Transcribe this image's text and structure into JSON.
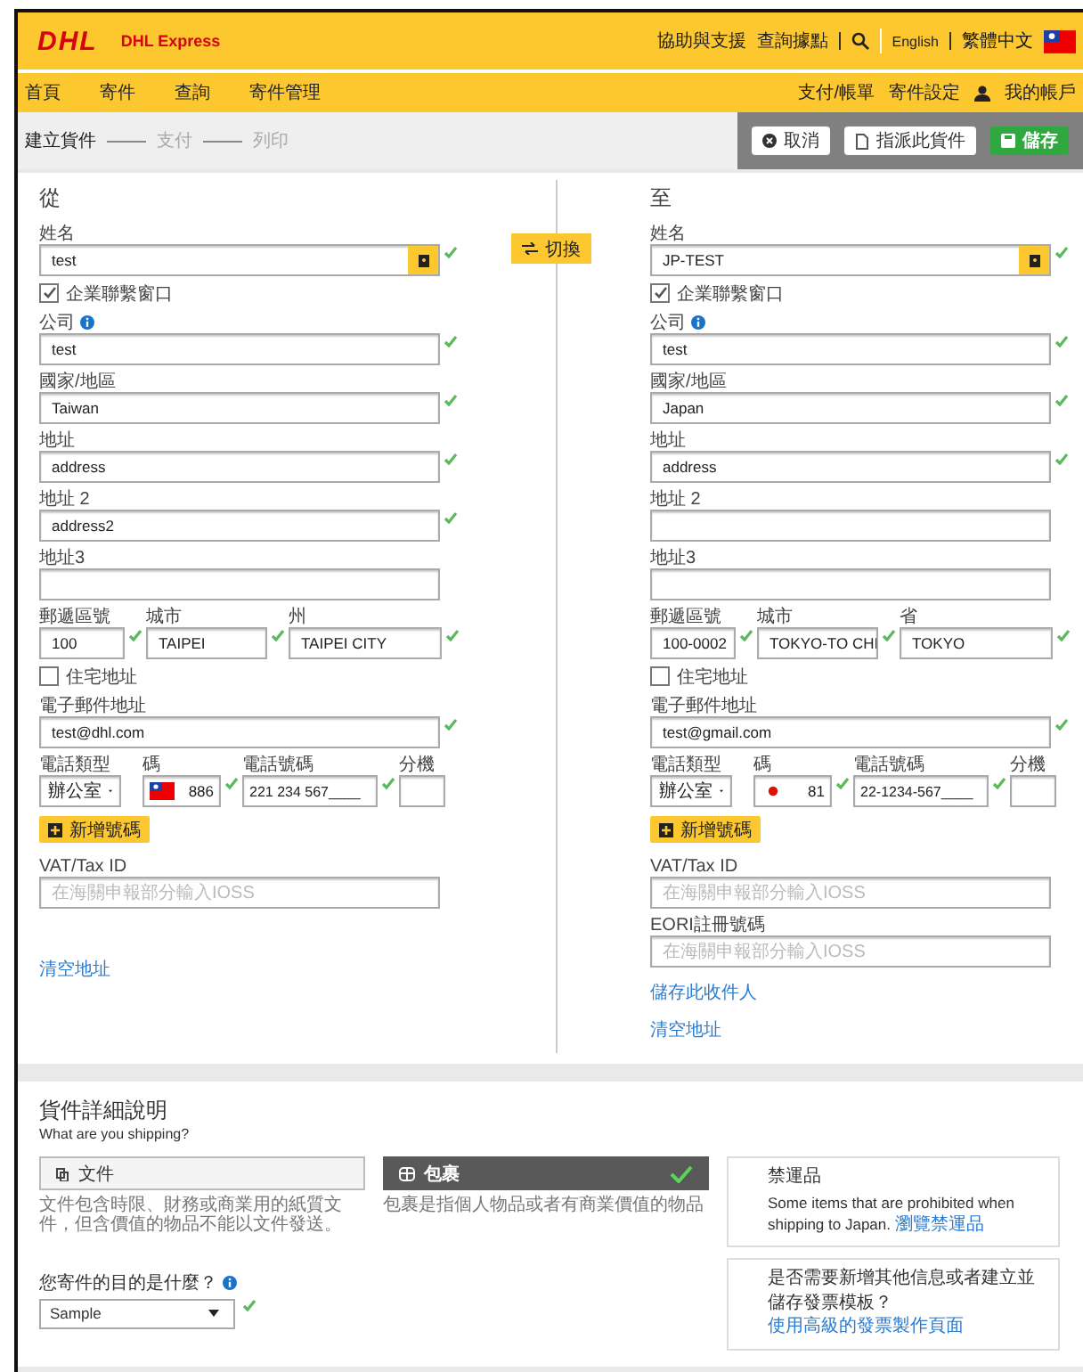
{
  "header": {
    "logo": "DHL",
    "brand": "DHL Express",
    "links": [
      "協助與支援",
      "查詢據點"
    ],
    "languages": [
      {
        "label": "English",
        "selected": false
      },
      {
        "label": "繁體中文",
        "selected": true
      }
    ]
  },
  "nav": {
    "items": [
      "首頁",
      "寄件",
      "查詢",
      "寄件管理"
    ],
    "account_links": [
      "支付/帳單",
      "寄件設定",
      "我的帳戶"
    ]
  },
  "steps": [
    {
      "label": "建立貨件",
      "selected": true
    },
    {
      "label": "支付",
      "selected": false
    },
    {
      "label": "列印",
      "selected": false
    }
  ],
  "actions": [
    {
      "label": "取消",
      "kind": "cancel"
    },
    {
      "label": "指派此貨件",
      "kind": "assign"
    },
    {
      "label": "儲存",
      "kind": "save"
    }
  ],
  "swap_button": "切換",
  "columns": [
    {
      "heading": "從",
      "rows": [
        [
          {
            "kind": "name",
            "label": "姓名",
            "value": "test",
            "valid": true
          }
        ],
        [
          {
            "kind": "checkbox",
            "label": "企業聯繫窗口",
            "checked": true
          }
        ],
        [
          {
            "kind": "text",
            "label": "公司",
            "info": true,
            "value": "test",
            "valid": true
          }
        ],
        [
          {
            "kind": "text",
            "label": "國家/地區",
            "value": "Taiwan",
            "valid": true
          }
        ],
        [
          {
            "kind": "text",
            "label": "地址",
            "value": "address",
            "valid": true
          }
        ],
        [
          {
            "kind": "text",
            "label": "地址 2",
            "value": "address2",
            "valid": true
          }
        ],
        [
          {
            "kind": "text",
            "label": "地址3",
            "valid": false
          }
        ],
        [
          {
            "kind": "text",
            "label": "郵遞區號",
            "value": "100",
            "valid": true
          },
          {
            "kind": "text",
            "label": "城市",
            "value": "TAIPEI",
            "valid": true
          },
          {
            "kind": "text",
            "label": "州",
            "value": "TAIPEI CITY",
            "valid": true
          }
        ],
        [
          {
            "kind": "checkbox",
            "label": "住宅地址",
            "checked": false
          }
        ],
        [
          {
            "kind": "text",
            "label": "電子郵件地址",
            "value": "test@dhl.com",
            "valid": true
          }
        ],
        [
          {
            "kind": "select",
            "label": "電話類型",
            "value": "辦公室",
            "valid": false
          },
          {
            "kind": "phone-code",
            "label": "碼",
            "flag": {
              "kind": "tw"
            },
            "value": "886",
            "valid": true
          },
          {
            "kind": "text",
            "label": "電話號碼",
            "value": "221 234 567____",
            "valid": true
          },
          {
            "kind": "text",
            "label": "分機",
            "valid": false
          }
        ],
        [
          {
            "kind": "add-button",
            "label": "新增號碼"
          }
        ],
        [
          {
            "kind": "text",
            "label": "VAT/Tax ID",
            "placeholder": "在海關申報部分輸入IOSS",
            "valid": false
          }
        ],
        [
          {
            "kind": "link",
            "label": "清空地址",
            "gap": true
          }
        ]
      ]
    },
    {
      "heading": "至",
      "rows": [
        [
          {
            "kind": "name",
            "label": "姓名",
            "value": "JP-TEST",
            "valid": true
          }
        ],
        [
          {
            "kind": "checkbox",
            "label": "企業聯繫窗口",
            "checked": true
          }
        ],
        [
          {
            "kind": "text",
            "label": "公司",
            "info": true,
            "value": "test",
            "valid": true
          }
        ],
        [
          {
            "kind": "text",
            "label": "國家/地區",
            "value": "Japan",
            "valid": true
          }
        ],
        [
          {
            "kind": "text",
            "label": "地址",
            "value": "address",
            "valid": true
          }
        ],
        [
          {
            "kind": "text",
            "label": "地址 2",
            "valid": false
          }
        ],
        [
          {
            "kind": "text",
            "label": "地址3",
            "valid": false
          }
        ],
        [
          {
            "kind": "text",
            "label": "郵遞區號",
            "value": "100-0002",
            "valid": true
          },
          {
            "kind": "text",
            "label": "城市",
            "value": "TOKYO-TO CHI",
            "valid": true
          },
          {
            "kind": "text",
            "label": "省",
            "value": "TOKYO",
            "valid": true
          }
        ],
        [
          {
            "kind": "checkbox",
            "label": "住宅地址",
            "checked": false
          }
        ],
        [
          {
            "kind": "text",
            "label": "電子郵件地址",
            "value": "test@gmail.com",
            "valid": true
          }
        ],
        [
          {
            "kind": "select",
            "label": "電話類型",
            "value": "辦公室",
            "valid": false
          },
          {
            "kind": "phone-code",
            "label": "碼",
            "flag": {
              "kind": "jp"
            },
            "value": "81",
            "valid": true
          },
          {
            "kind": "text",
            "label": "電話號碼",
            "value": "22-1234-567____",
            "valid": true
          },
          {
            "kind": "text",
            "label": "分機",
            "valid": false
          }
        ],
        [
          {
            "kind": "add-button",
            "label": "新增號碼"
          }
        ],
        [
          {
            "kind": "text",
            "label": "VAT/Tax ID",
            "placeholder": "在海關申報部分輸入IOSS",
            "valid": false
          }
        ],
        [
          {
            "kind": "text",
            "label": "EORI註冊號碼",
            "placeholder": "在海關申報部分輸入IOSS",
            "valid": false
          }
        ],
        [
          {
            "kind": "link",
            "label": "儲存此收件人"
          }
        ],
        [
          {
            "kind": "link",
            "label": "清空地址"
          }
        ]
      ]
    }
  ],
  "shipment": {
    "heading": "貨件詳細說明",
    "subheading": "What are you shipping?",
    "types": [
      {
        "label": "文件",
        "kind": "document",
        "selected": false,
        "description": "文件包含時限、財務或商業用的紙質文件，但含價值的物品不能以文件發送。"
      },
      {
        "label": "包裹",
        "kind": "package",
        "selected": true,
        "description": "包裹是指個人物品或者有商業價值的物品"
      }
    ],
    "purpose": {
      "label": "您寄件的目的是什麼？",
      "info": true,
      "value": "Sample",
      "valid": true
    },
    "notices": [
      {
        "title": "禁運品",
        "text": "Some items that are prohibited when shipping to Japan.",
        "link": "瀏覽禁運品"
      },
      {
        "text": "是否需要新增其他信息或者建立並儲存發票模板？",
        "link": "使用高級的發票製作頁面"
      }
    ]
  }
}
